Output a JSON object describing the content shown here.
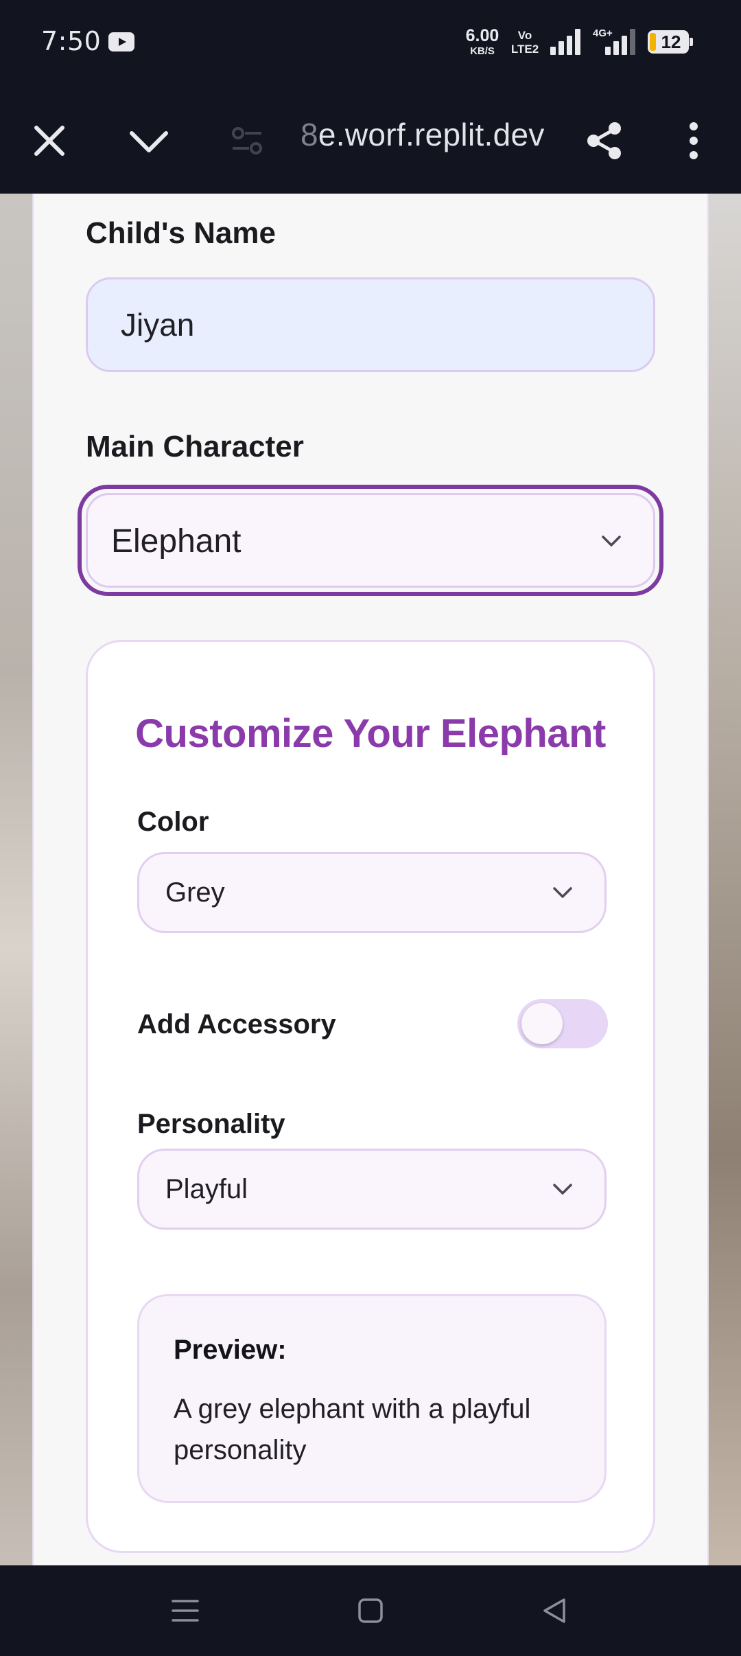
{
  "status_bar": {
    "time": "7:50",
    "net_speed_value": "6.00",
    "net_speed_unit": "KB/S",
    "volte_line1": "Vo",
    "volte_line2": "LTE2",
    "signal2_label": "4G+",
    "battery_level": "12",
    "battery_accent_color": "#f5b301"
  },
  "browser": {
    "url_prefix": "8",
    "url_rest": "e.worf.replit.dev",
    "icons": [
      "close-icon",
      "chevron-down-icon",
      "site-settings-icon",
      "share-icon",
      "more-vert-icon"
    ]
  },
  "form": {
    "child_name_label": "Child's Name",
    "child_name_value": "Jiyan",
    "main_character_label": "Main Character",
    "main_character_value": "Elephant",
    "customize": {
      "title": "Customize Your Elephant",
      "color_label": "Color",
      "color_value": "Grey",
      "accessory_label": "Add Accessory",
      "accessory_enabled": false,
      "personality_label": "Personality",
      "personality_value": "Playful",
      "preview_label": "Preview:",
      "preview_text": "A grey elephant with a playful personality"
    }
  },
  "theme": {
    "accent_purple": "#8a3aaa",
    "focus_border": "#7d3aa0",
    "input_bg": "#e8eefd"
  },
  "nav_bar": {
    "icons": [
      "recent-apps-icon",
      "home-icon",
      "back-icon"
    ]
  }
}
